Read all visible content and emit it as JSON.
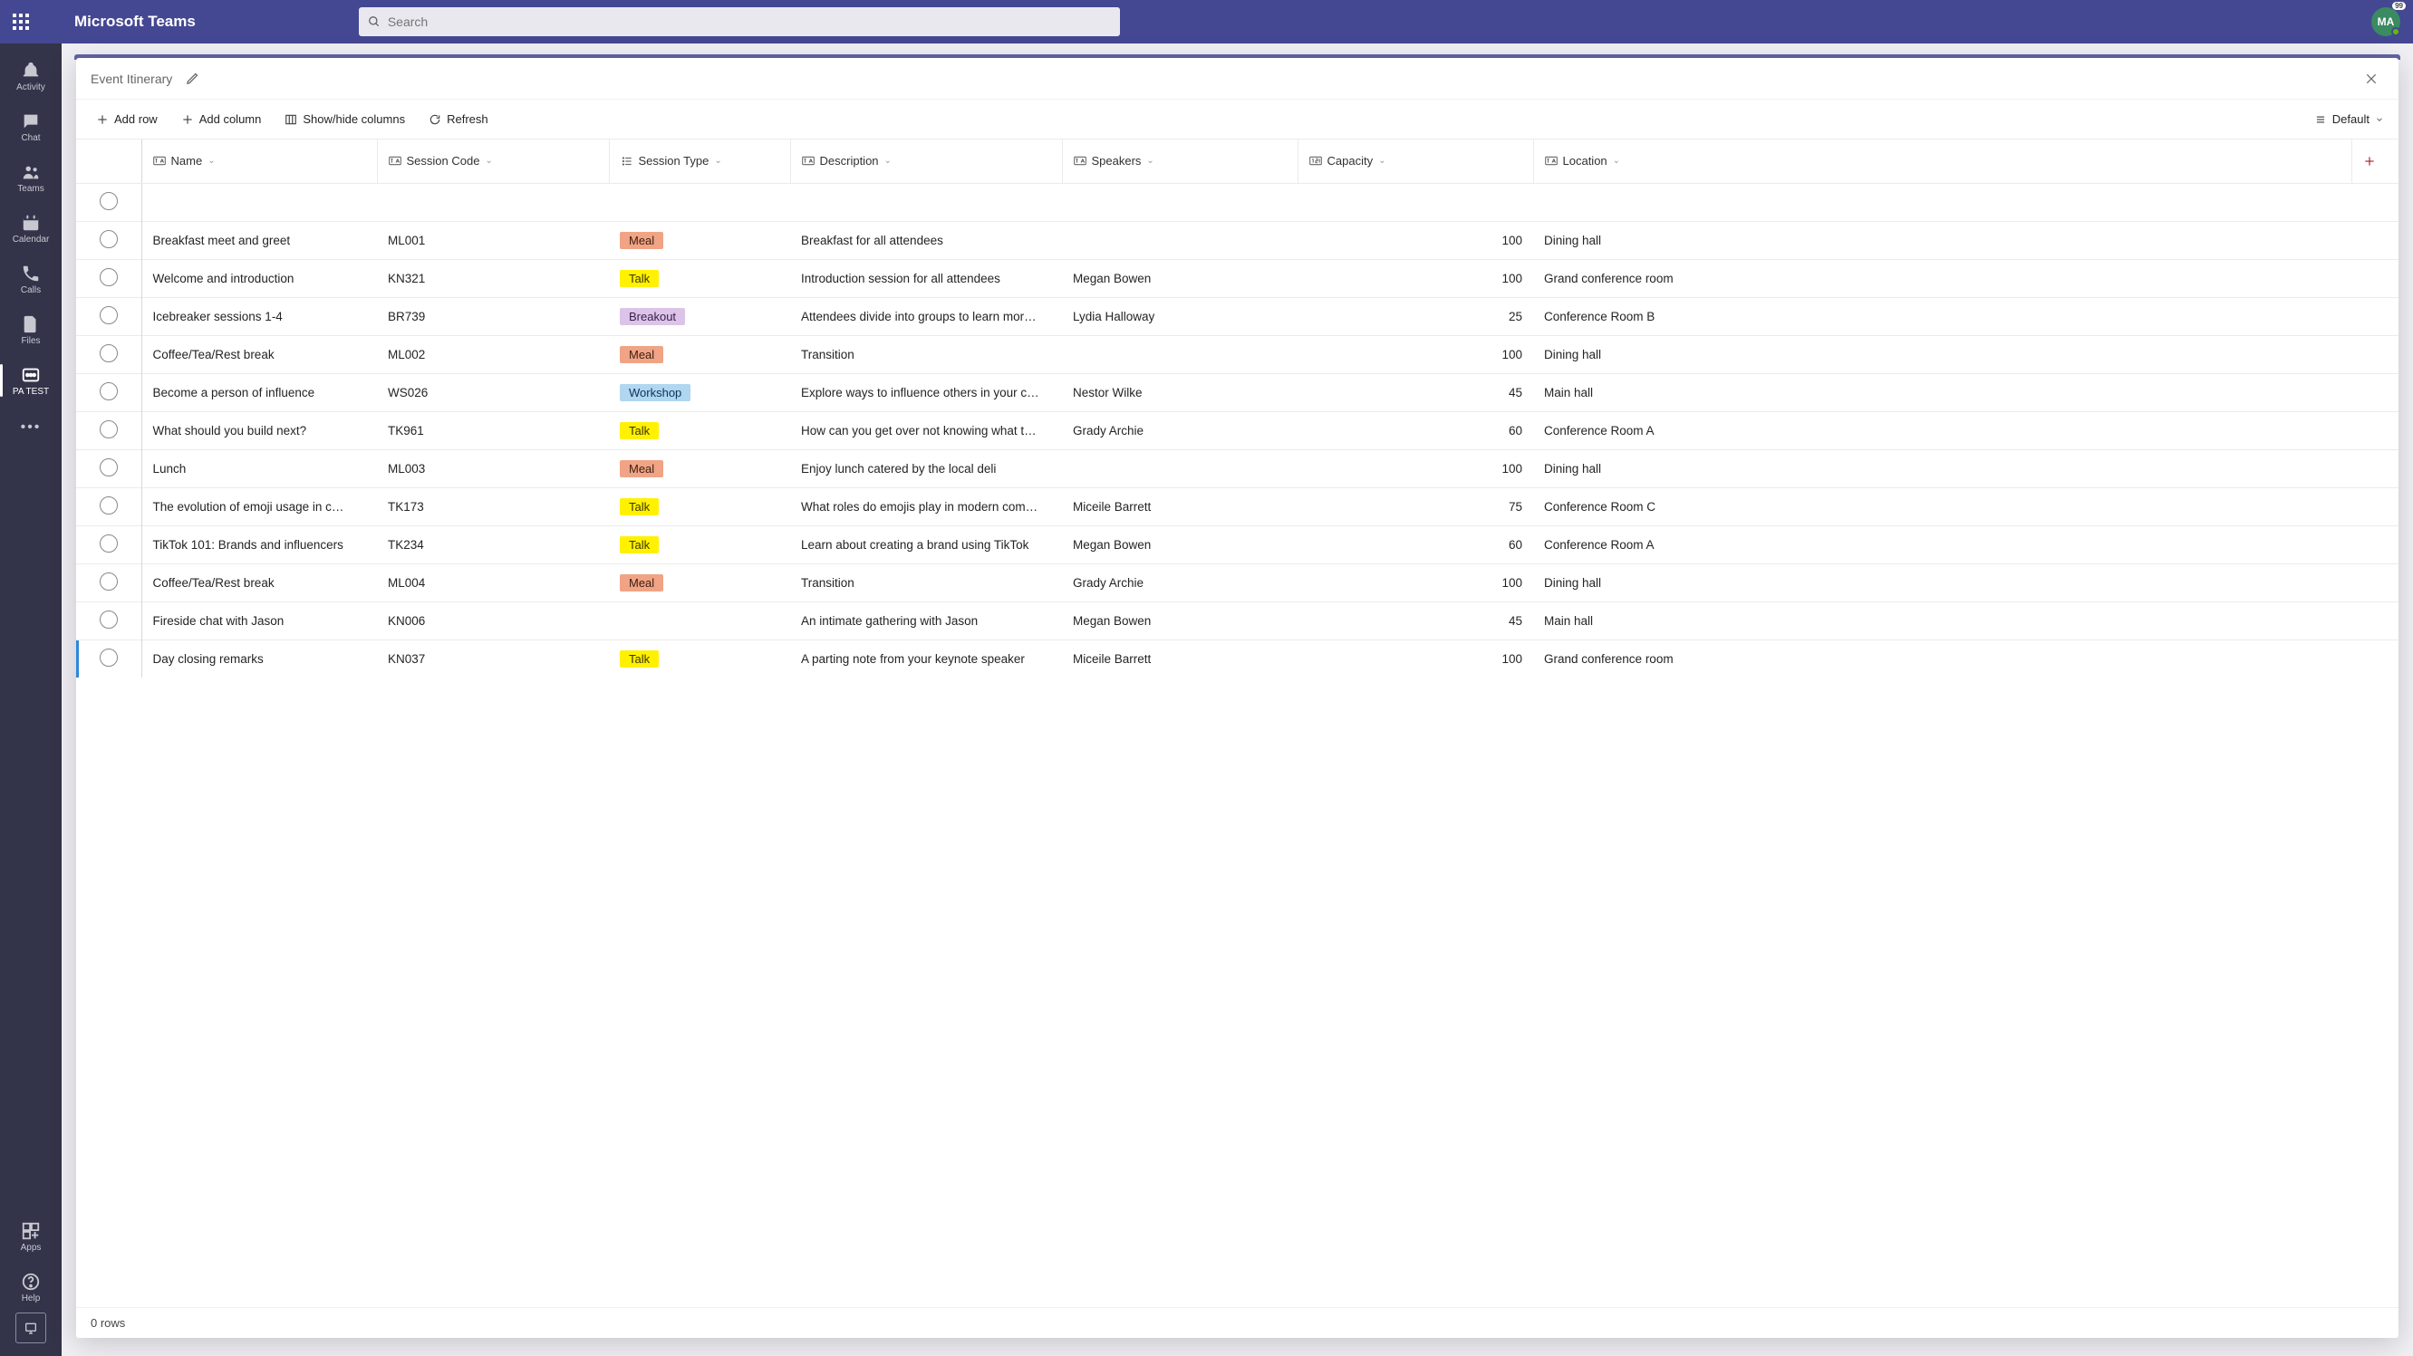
{
  "app": {
    "name": "Microsoft Teams",
    "avatar_initials": "MA",
    "avatar_badge": "99"
  },
  "search": {
    "placeholder": "Search"
  },
  "rail": [
    {
      "id": "activity",
      "label": "Activity"
    },
    {
      "id": "chat",
      "label": "Chat"
    },
    {
      "id": "teams",
      "label": "Teams"
    },
    {
      "id": "calendar",
      "label": "Calendar"
    },
    {
      "id": "calls",
      "label": "Calls"
    },
    {
      "id": "files",
      "label": "Files"
    },
    {
      "id": "patest",
      "label": "PA TEST",
      "active": true
    },
    {
      "id": "apps",
      "label": "Apps"
    },
    {
      "id": "help",
      "label": "Help"
    }
  ],
  "dialog": {
    "title": "Event Itinerary"
  },
  "toolbar": {
    "add_row": "Add row",
    "add_column": "Add column",
    "show_hide": "Show/hide columns",
    "refresh": "Refresh",
    "layout_label": "Default"
  },
  "columns": {
    "name": "Name",
    "code": "Session Code",
    "type": "Session Type",
    "desc": "Description",
    "speakers": "Speakers",
    "capacity": "Capacity",
    "location": "Location"
  },
  "tags": {
    "Meal": {
      "label": "Meal",
      "class": "tag-meal"
    },
    "Talk": {
      "label": "Talk",
      "class": "tag-talk"
    },
    "Breakout": {
      "label": "Breakout",
      "class": "tag-breakout"
    },
    "Workshop": {
      "label": "Workshop",
      "class": "tag-workshop"
    }
  },
  "rows": [
    {
      "name": "Breakfast meet and greet",
      "code": "ML001",
      "type": "Meal",
      "desc": "Breakfast for all attendees",
      "speakers": "",
      "capacity": 100,
      "location": "Dining hall"
    },
    {
      "name": "Welcome and introduction",
      "code": "KN321",
      "type": "Talk",
      "desc": "Introduction session for all attendees",
      "speakers": "Megan Bowen",
      "capacity": 100,
      "location": "Grand conference room"
    },
    {
      "name": "Icebreaker sessions 1-4",
      "code": "BR739",
      "type": "Breakout",
      "desc": "Attendees divide into groups to learn mor…",
      "speakers": "Lydia Halloway",
      "capacity": 25,
      "location": "Conference Room B"
    },
    {
      "name": "Coffee/Tea/Rest break",
      "code": "ML002",
      "type": "Meal",
      "desc": "Transition",
      "speakers": "",
      "capacity": 100,
      "location": "Dining hall"
    },
    {
      "name": "Become a person of influence",
      "code": "WS026",
      "type": "Workshop",
      "desc": "Explore ways to influence others in your c…",
      "speakers": "Nestor Wilke",
      "capacity": 45,
      "location": "Main hall"
    },
    {
      "name": "What should you build next?",
      "code": "TK961",
      "type": "Talk",
      "desc": "How can you get over not knowing what t…",
      "speakers": "Grady Archie",
      "capacity": 60,
      "location": "Conference Room A"
    },
    {
      "name": "Lunch",
      "code": "ML003",
      "type": "Meal",
      "desc": "Enjoy lunch catered by the local deli",
      "speakers": "",
      "capacity": 100,
      "location": "Dining hall"
    },
    {
      "name": "The evolution of emoji usage in c…",
      "code": "TK173",
      "type": "Talk",
      "desc": "What roles do emojis play in modern com…",
      "speakers": "Miceile Barrett",
      "capacity": 75,
      "location": "Conference Room C"
    },
    {
      "name": "TikTok 101: Brands and influencers",
      "code": "TK234",
      "type": "Talk",
      "desc": "Learn about creating a brand using TikTok",
      "speakers": "Megan Bowen",
      "capacity": 60,
      "location": "Conference Room A"
    },
    {
      "name": "Coffee/Tea/Rest break",
      "code": "ML004",
      "type": "Meal",
      "desc": "Transition",
      "speakers": "Grady Archie",
      "capacity": 100,
      "location": "Dining hall"
    },
    {
      "name": "Fireside chat with Jason",
      "code": "KN006",
      "type": "",
      "desc": "An intimate gathering with Jason",
      "speakers": "Megan Bowen",
      "capacity": 45,
      "location": "Main hall"
    },
    {
      "name": "Day closing remarks",
      "code": "KN037",
      "type": "Talk",
      "desc": "A parting note from your keynote speaker",
      "speakers": "Miceile Barrett",
      "capacity": 100,
      "location": "Grand conference room"
    }
  ],
  "footer": {
    "row_count": "0 rows"
  }
}
